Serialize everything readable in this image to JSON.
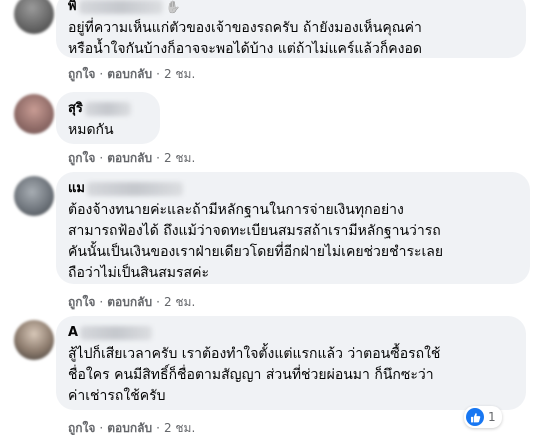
{
  "comments": [
    {
      "author": "พิ",
      "text": "อยู่ที่ความเห็นแก่ตัวของเจ้าของรถครับ ถ้ายังมองเห็นคุณค่า\nหรือน้ำใจกันบ้างก็อาจจะพอได้บ้าง แต่ถ้าไม่แคร์แล้วก็คงอด",
      "like_label": "ถูกใจ",
      "reply_label": "ตอบกลับ",
      "time": "2 ชม."
    },
    {
      "author": "สุริ",
      "text": "หมดกัน",
      "like_label": "ถูกใจ",
      "reply_label": "ตอบกลับ",
      "time": "2 ชม."
    },
    {
      "author": "แม",
      "text": "ต้องจ้างทนายค่ะและถ้ามีหลักฐานในการจ่ายเงินทุกอย่าง\nสามารถฟ้องได้ ถึงแม้ว่าจดทะเบียนสมรสถ้าเรามีหลักฐานว่ารถ\nคันนั้นเป็นเงินของเราฝ่ายเดียวโดยที่อีกฝ่ายไม่เคยช่วยชำระเลย\nถือว่าไม่เป็นสินสมรสค่ะ",
      "like_label": "ถูกใจ",
      "reply_label": "ตอบกลับ",
      "time": "2 ชม."
    },
    {
      "author": "A",
      "text": "สู้ไปก็เสียเวลาครับ เราต้องทำใจตั้งแต่แรกแล้ว ว่าตอนซื้อรถใช้\nชื่อใคร คนมีสิทธิ์ก็ชื่อตามสัญญา ส่วนที่ช่วยผ่อนมา ก็นึกซะว่า\nค่าเช่ารถใช้ครับ",
      "like_label": "ถูกใจ",
      "reply_label": "ตอบกลับ",
      "time": "2 ชม.",
      "reaction_count": "1"
    }
  ],
  "separator": "·",
  "icons": {
    "like": "like-thumb-icon"
  },
  "colors": {
    "bubble": "#f0f2f5",
    "meta": "#65676b",
    "like_blue": "#1877f2"
  }
}
